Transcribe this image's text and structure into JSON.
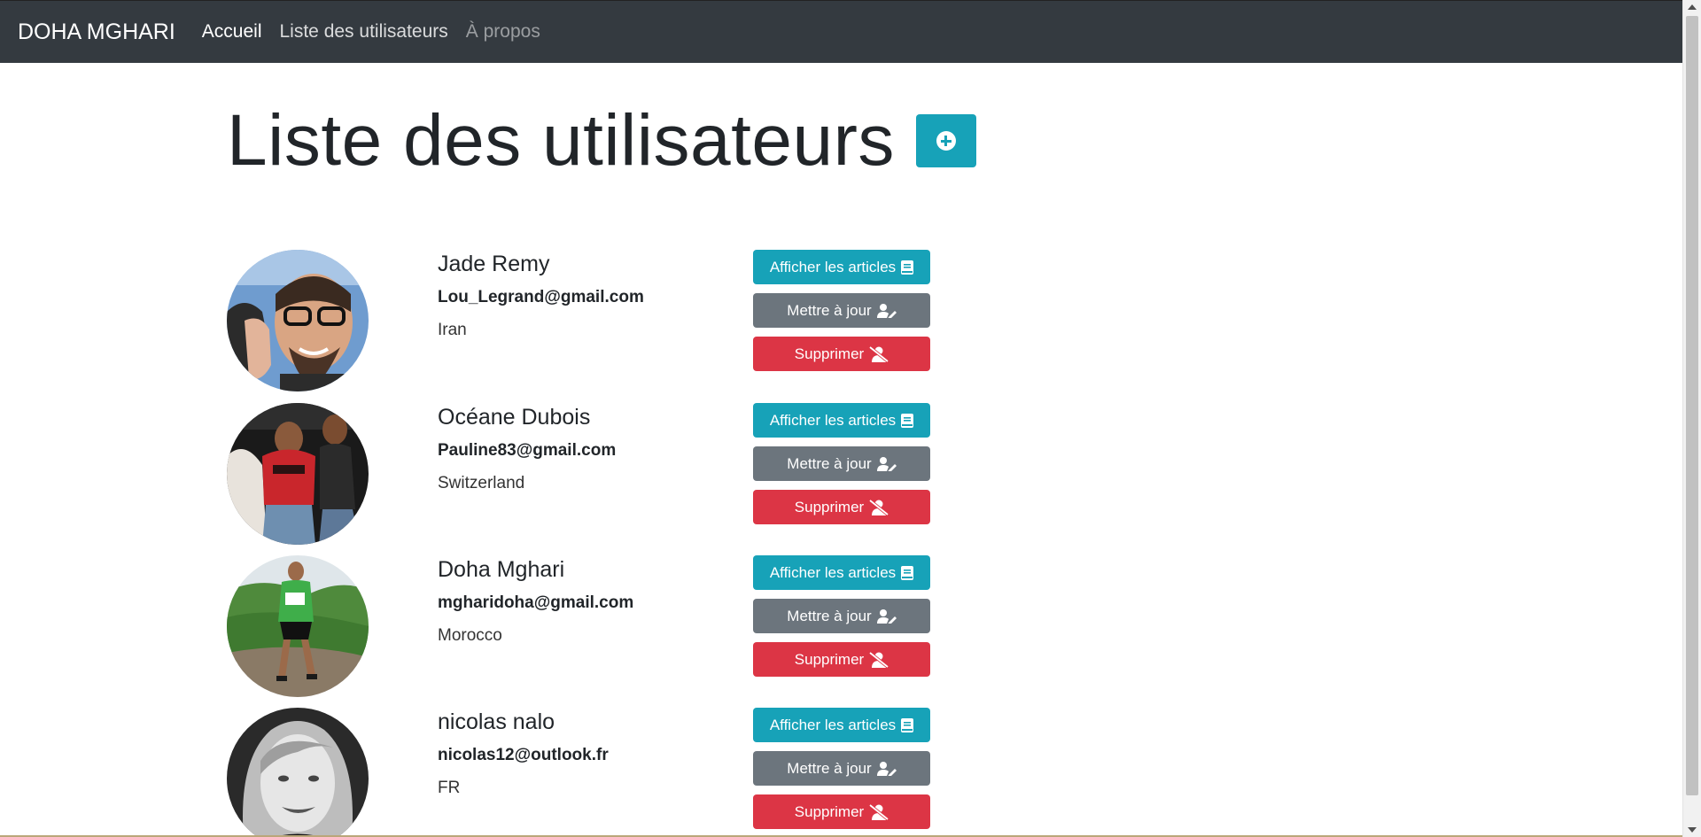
{
  "navbar": {
    "brand": "DOHA MGHARI",
    "links": [
      {
        "label": "Accueil"
      },
      {
        "label": "Liste des utilisateurs"
      },
      {
        "label": "À propos"
      }
    ]
  },
  "page": {
    "title": "Liste des utilisateurs"
  },
  "buttons": {
    "articles": "Afficher les articles",
    "update": "Mettre à jour",
    "delete": "Supprimer"
  },
  "users": [
    {
      "name": "Jade Remy",
      "email": "Lou_Legrand@gmail.com",
      "country": "Iran"
    },
    {
      "name": "Océane Dubois",
      "email": "Pauline83@gmail.com",
      "country": "Switzerland"
    },
    {
      "name": "Doha Mghari",
      "email": "mgharidoha@gmail.com",
      "country": "Morocco"
    },
    {
      "name": "nicolas nalo",
      "email": "nicolas12@outlook.fr",
      "country": "FR"
    }
  ],
  "colors": {
    "navbar": "#343a40",
    "info": "#17a2b8",
    "secondary": "#6c757d",
    "danger": "#dc3545"
  }
}
